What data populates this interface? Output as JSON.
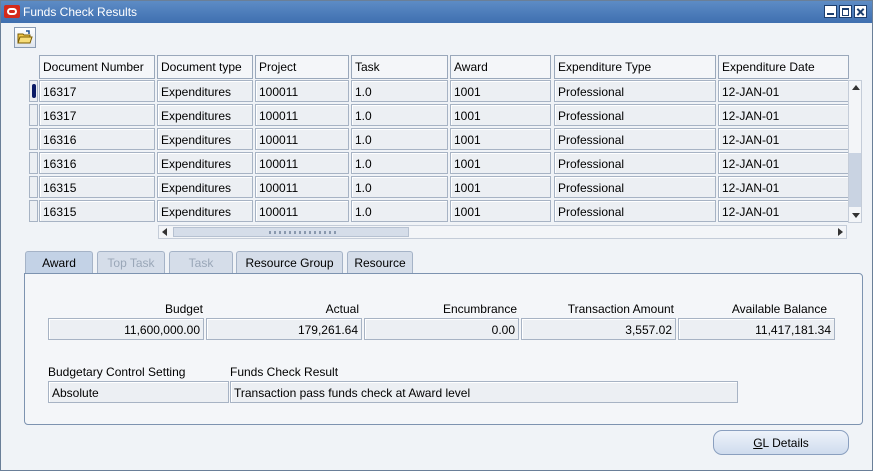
{
  "window": {
    "title": "Funds Check Results"
  },
  "table": {
    "columns": [
      "Document Number",
      "Document type",
      "Project",
      "Task",
      "Award",
      "Expenditure Type",
      "Expenditure Date"
    ],
    "rows": [
      [
        "16317",
        "Expenditures",
        "100011",
        "1.0",
        "1001",
        "Professional",
        "12-JAN-01"
      ],
      [
        "16317",
        "Expenditures",
        "100011",
        "1.0",
        "1001",
        "Professional",
        "12-JAN-01"
      ],
      [
        "16316",
        "Expenditures",
        "100011",
        "1.0",
        "1001",
        "Professional",
        "12-JAN-01"
      ],
      [
        "16316",
        "Expenditures",
        "100011",
        "1.0",
        "1001",
        "Professional",
        "12-JAN-01"
      ],
      [
        "16315",
        "Expenditures",
        "100011",
        "1.0",
        "1001",
        "Professional",
        "12-JAN-01"
      ],
      [
        "16315",
        "Expenditures",
        "100011",
        "1.0",
        "1001",
        "Professional",
        "12-JAN-01"
      ]
    ],
    "selected_row": 0
  },
  "tabs": [
    {
      "label": "Award",
      "state": "active"
    },
    {
      "label": "Top Task",
      "state": "disabled"
    },
    {
      "label": "Task",
      "state": "disabled"
    },
    {
      "label": "Resource Group",
      "state": "normal"
    },
    {
      "label": "Resource",
      "state": "normal"
    }
  ],
  "award": {
    "budget_label": "Budget",
    "budget": "11,600,000.00",
    "actual_label": "Actual",
    "actual": "179,261.64",
    "encumbrance_label": "Encumbrance",
    "encumbrance": "0.00",
    "transaction_amount_label": "Transaction Amount",
    "transaction_amount": "3,557.02",
    "available_balance_label": "Available Balance",
    "available_balance": "11,417,181.34",
    "control_setting_label": "Budgetary Control Setting",
    "control_setting": "Absolute",
    "result_label": "Funds Check Result",
    "result": "Transaction pass funds check at Award level"
  },
  "buttons": {
    "gl_details_prefix": "G",
    "gl_details_rest": "L Details"
  },
  "icons": {
    "open_folder": "open-folder-icon",
    "title_logo": "oracle-logo-icon"
  }
}
